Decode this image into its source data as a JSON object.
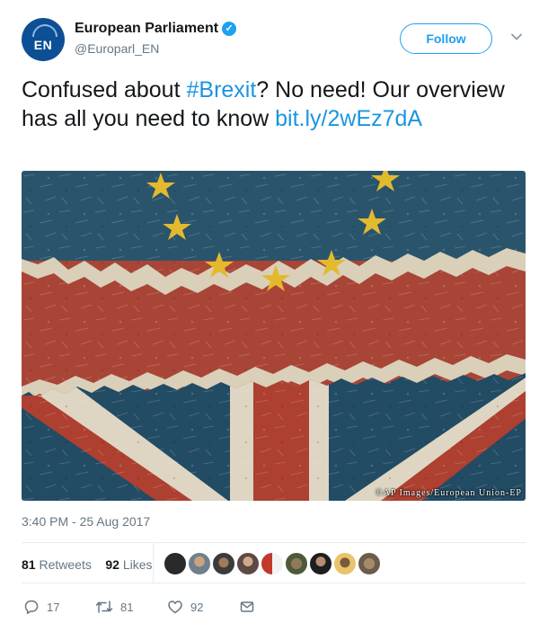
{
  "account": {
    "avatar_text": "EN",
    "name": "European Parliament",
    "verified_glyph": "✓",
    "handle": "@Europarl_EN",
    "follow_label": "Follow"
  },
  "tweet": {
    "text_before": "Confused about ",
    "hashtag": "#Brexit",
    "text_after": "? No need! Our overview has all you need to know ",
    "link": "bit.ly/2wEz7dA"
  },
  "media": {
    "credit": "©AP Images/European Union-EP"
  },
  "timestamp": "3:40 PM - 25 Aug 2017",
  "stats": {
    "retweets_count": "81",
    "retweets_label": "Retweets",
    "likes_count": "92",
    "likes_label": "Likes"
  },
  "actions": {
    "replies": "17",
    "retweets": "81",
    "likes": "92"
  },
  "colors": {
    "accent": "#1da1f2",
    "link": "#1b95e0",
    "muted": "#657786"
  },
  "icons": [
    "verified-badge-icon",
    "chevron-down-icon",
    "reply-icon",
    "retweet-icon",
    "like-icon",
    "direct-message-icon"
  ]
}
